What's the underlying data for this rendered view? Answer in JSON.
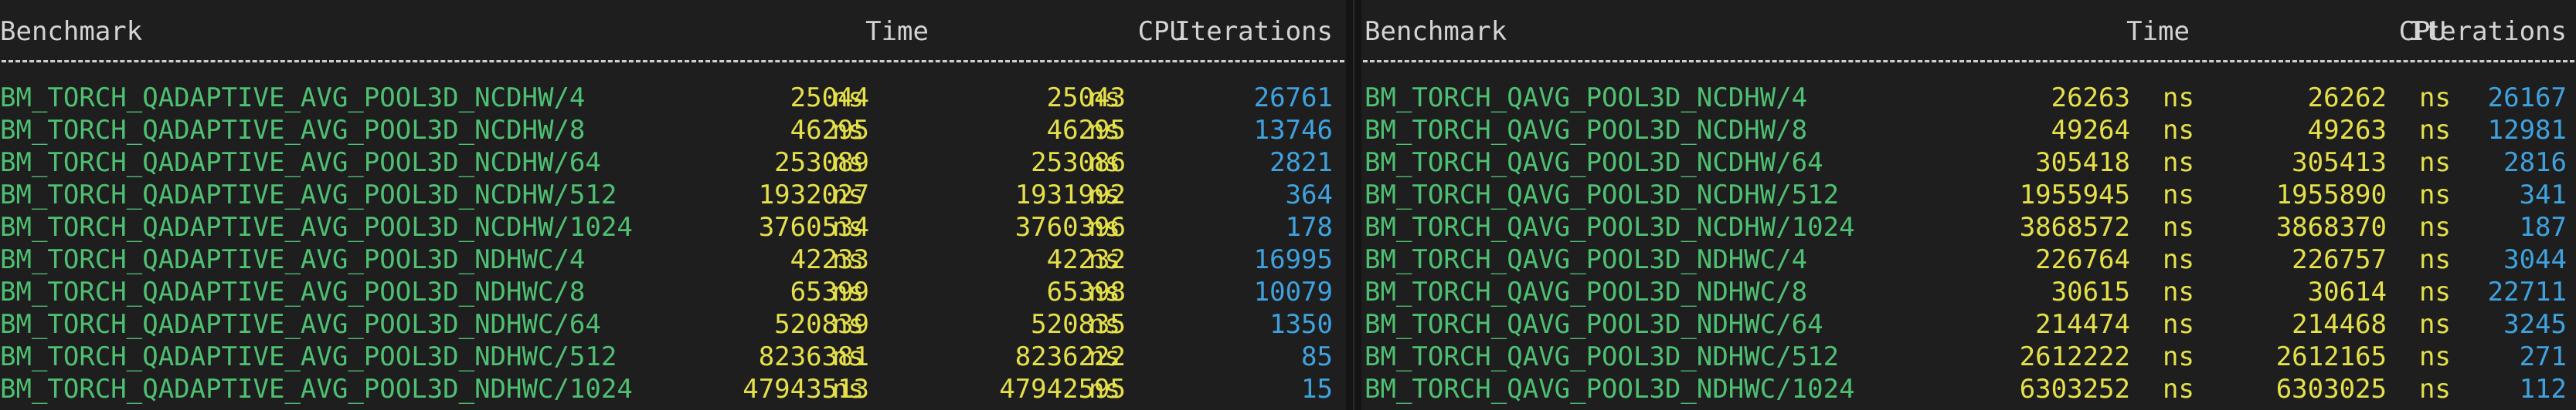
{
  "colors": {
    "background": "#1e1e1e",
    "header_text": "#d4d4d4",
    "benchmark_name": "#4ec072",
    "time_values": "#e5e04a",
    "iterations": "#3fa2de"
  },
  "left": {
    "headers": {
      "benchmark": "Benchmark",
      "time": "Time",
      "cpu": "CPU",
      "iterations": "Iterations"
    },
    "separator": "---------------------------------------------------------------------------------------------------",
    "rows": [
      {
        "name": "BM_TORCH_QADAPTIVE_AVG_POOL3D_NCDHW/4",
        "time": "25044",
        "time_unit": "ns",
        "cpu": "25043",
        "cpu_unit": "ns",
        "iterations": "26761"
      },
      {
        "name": "BM_TORCH_QADAPTIVE_AVG_POOL3D_NCDHW/8",
        "time": "46295",
        "time_unit": "ns",
        "cpu": "46295",
        "cpu_unit": "ns",
        "iterations": "13746"
      },
      {
        "name": "BM_TORCH_QADAPTIVE_AVG_POOL3D_NCDHW/64",
        "time": "253089",
        "time_unit": "ns",
        "cpu": "253086",
        "cpu_unit": "ns",
        "iterations": "2821"
      },
      {
        "name": "BM_TORCH_QADAPTIVE_AVG_POOL3D_NCDHW/512",
        "time": "1932027",
        "time_unit": "ns",
        "cpu": "1931992",
        "cpu_unit": "ns",
        "iterations": "364"
      },
      {
        "name": "BM_TORCH_QADAPTIVE_AVG_POOL3D_NCDHW/1024",
        "time": "3760534",
        "time_unit": "ns",
        "cpu": "3760396",
        "cpu_unit": "ns",
        "iterations": "178"
      },
      {
        "name": "BM_TORCH_QADAPTIVE_AVG_POOL3D_NDHWC/4",
        "time": "42233",
        "time_unit": "ns",
        "cpu": "42232",
        "cpu_unit": "ns",
        "iterations": "16995"
      },
      {
        "name": "BM_TORCH_QADAPTIVE_AVG_POOL3D_NDHWC/8",
        "time": "65399",
        "time_unit": "ns",
        "cpu": "65398",
        "cpu_unit": "ns",
        "iterations": "10079"
      },
      {
        "name": "BM_TORCH_QADAPTIVE_AVG_POOL3D_NDHWC/64",
        "time": "520839",
        "time_unit": "ns",
        "cpu": "520835",
        "cpu_unit": "ns",
        "iterations": "1350"
      },
      {
        "name": "BM_TORCH_QADAPTIVE_AVG_POOL3D_NDHWC/512",
        "time": "8236381",
        "time_unit": "ns",
        "cpu": "8236222",
        "cpu_unit": "ns",
        "iterations": "85"
      },
      {
        "name": "BM_TORCH_QADAPTIVE_AVG_POOL3D_NDHWC/1024",
        "time": "47943513",
        "time_unit": "ns",
        "cpu": "47942595",
        "cpu_unit": "ns",
        "iterations": "15"
      }
    ]
  },
  "right": {
    "headers": {
      "benchmark": "Benchmark",
      "time": "Time",
      "cpu": "CPU",
      "iterations": "Iterations"
    },
    "separator": "--------------------------------------------------------------------------------------------",
    "rows": [
      {
        "name": "BM_TORCH_QAVG_POOL3D_NCDHW/4",
        "time": "26263",
        "time_unit": "ns",
        "cpu": "26262",
        "cpu_unit": "ns",
        "iterations": "26167"
      },
      {
        "name": "BM_TORCH_QAVG_POOL3D_NCDHW/8",
        "time": "49264",
        "time_unit": "ns",
        "cpu": "49263",
        "cpu_unit": "ns",
        "iterations": "12981"
      },
      {
        "name": "BM_TORCH_QAVG_POOL3D_NCDHW/64",
        "time": "305418",
        "time_unit": "ns",
        "cpu": "305413",
        "cpu_unit": "ns",
        "iterations": "2816"
      },
      {
        "name": "BM_TORCH_QAVG_POOL3D_NCDHW/512",
        "time": "1955945",
        "time_unit": "ns",
        "cpu": "1955890",
        "cpu_unit": "ns",
        "iterations": "341"
      },
      {
        "name": "BM_TORCH_QAVG_POOL3D_NCDHW/1024",
        "time": "3868572",
        "time_unit": "ns",
        "cpu": "3868370",
        "cpu_unit": "ns",
        "iterations": "187"
      },
      {
        "name": "BM_TORCH_QAVG_POOL3D_NDHWC/4",
        "time": "226764",
        "time_unit": "ns",
        "cpu": "226757",
        "cpu_unit": "ns",
        "iterations": "3044"
      },
      {
        "name": "BM_TORCH_QAVG_POOL3D_NDHWC/8",
        "time": "30615",
        "time_unit": "ns",
        "cpu": "30614",
        "cpu_unit": "ns",
        "iterations": "22711"
      },
      {
        "name": "BM_TORCH_QAVG_POOL3D_NDHWC/64",
        "time": "214474",
        "time_unit": "ns",
        "cpu": "214468",
        "cpu_unit": "ns",
        "iterations": "3245"
      },
      {
        "name": "BM_TORCH_QAVG_POOL3D_NDHWC/512",
        "time": "2612222",
        "time_unit": "ns",
        "cpu": "2612165",
        "cpu_unit": "ns",
        "iterations": "271"
      },
      {
        "name": "BM_TORCH_QAVG_POOL3D_NDHWC/1024",
        "time": "6303252",
        "time_unit": "ns",
        "cpu": "6303025",
        "cpu_unit": "ns",
        "iterations": "112"
      }
    ]
  }
}
